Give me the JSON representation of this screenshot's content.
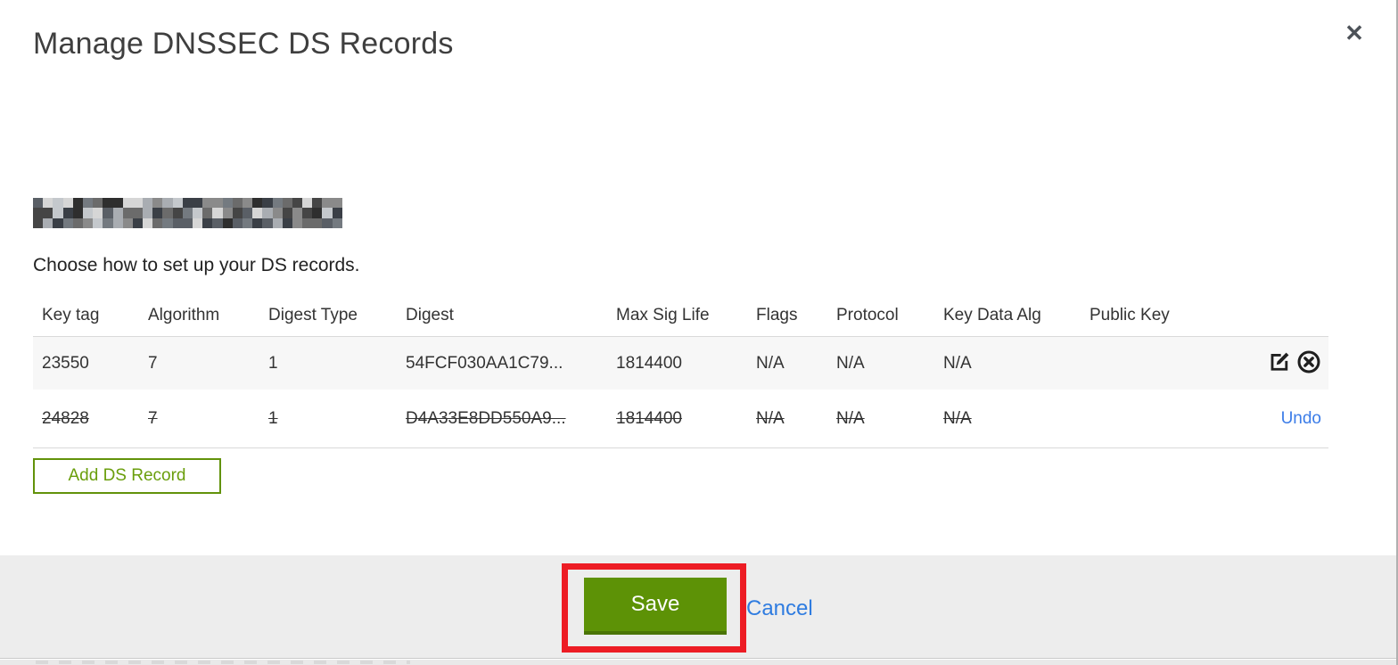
{
  "modal": {
    "title": "Manage DNSSEC DS Records",
    "close_icon": "✕",
    "instruction": "Choose how to set up your DS records.",
    "table": {
      "headers": [
        "Key tag",
        "Algorithm",
        "Digest Type",
        "Digest",
        "Max Sig Life",
        "Flags",
        "Protocol",
        "Key Data Alg",
        "Public Key"
      ],
      "rows": [
        {
          "key_tag": "23550",
          "algorithm": "7",
          "digest_type": "1",
          "digest": "54FCF030AA1C79...",
          "max_sig_life": "1814400",
          "flags": "N/A",
          "protocol": "N/A",
          "key_data_alg": "N/A",
          "public_key": "",
          "state": "normal"
        },
        {
          "key_tag": "24828",
          "algorithm": "7",
          "digest_type": "1",
          "digest": "D4A33E8DD550A9...",
          "max_sig_life": "1814400",
          "flags": "N/A",
          "protocol": "N/A",
          "key_data_alg": "N/A",
          "public_key": "",
          "state": "marked-for-deletion",
          "undo_label": "Undo"
        }
      ]
    },
    "add_button_label": "Add DS Record",
    "footer": {
      "save_label": "Save",
      "cancel_label": "Cancel"
    }
  },
  "colors": {
    "accent_green": "#5d9206",
    "accent_green_dark": "#4a7405",
    "outline_green": "#62920a",
    "link_blue": "#2f7ce0",
    "annotation_red": "#ed1c24",
    "footer_gray": "#ededed",
    "row_stripe_gray": "#f7f7f7"
  }
}
